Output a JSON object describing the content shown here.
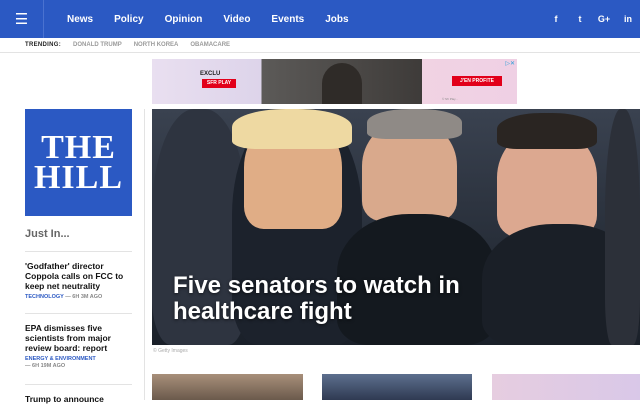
{
  "header": {
    "menu_icon": "hamburger-icon",
    "nav": [
      "News",
      "Policy",
      "Opinion",
      "Video",
      "Events",
      "Jobs"
    ],
    "social": [
      {
        "icon": "facebook-icon",
        "glyph": "f"
      },
      {
        "icon": "twitter-icon",
        "glyph": "t"
      },
      {
        "icon": "google-plus-icon",
        "glyph": "G+"
      },
      {
        "icon": "linkedin-icon",
        "glyph": "in"
      }
    ],
    "brand_color": "#2b59c3"
  },
  "trending": {
    "label": "TRENDING:",
    "items": [
      "DONALD TRUMP",
      "NORTH KOREA",
      "OBAMACARE"
    ]
  },
  "ad": {
    "headline": "EXCLU",
    "brand": "SFR PLAY",
    "cta": "J'EN PROFITE",
    "adchoices": "▷✕",
    "fine_print": "© Sfr Play..."
  },
  "logo": {
    "line1": "THE",
    "line2": "HILL"
  },
  "sidebar": {
    "title": "Just In...",
    "stories": [
      {
        "headline": "'Godfather' director Coppola calls on FCC to keep net neutrality",
        "category": "TECHNOLOGY",
        "time": "— 6H 3M AGO"
      },
      {
        "headline": "EPA dismisses five scientists from major review board: report",
        "category": "ENERGY & ENVIRONMENT",
        "time": "— 6H 19M AGO"
      },
      {
        "headline": "Trump to announce",
        "category": "",
        "time": ""
      }
    ]
  },
  "hero": {
    "headline_line1": "Five senators to watch in",
    "headline_line2": "healthcare fight",
    "credit": "© Getty Images"
  }
}
